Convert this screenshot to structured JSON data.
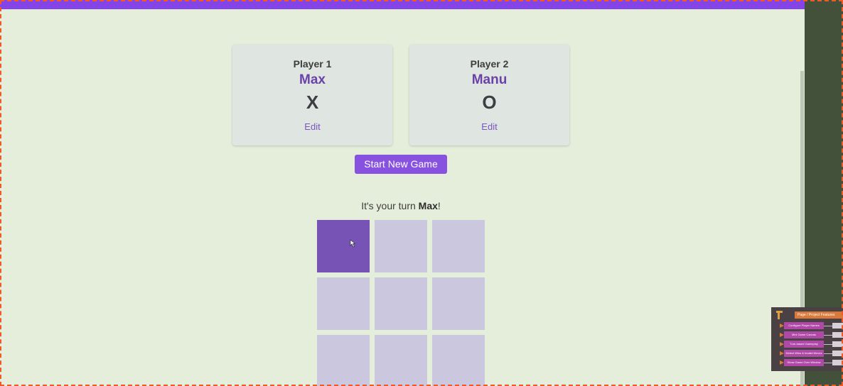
{
  "players": [
    {
      "label": "Player 1",
      "name": "Max",
      "symbol": "X",
      "edit_label": "Edit"
    },
    {
      "label": "Player 2",
      "name": "Manu",
      "symbol": "O",
      "edit_label": "Edit"
    }
  ],
  "start_button_label": "Start New Game",
  "turn": {
    "prefix": "It's your turn ",
    "player": "Max",
    "suffix": "!"
  },
  "board": {
    "cells": [
      "",
      "",
      "",
      "",
      "",
      "",
      "",
      "",
      ""
    ],
    "hovered_cell": 0
  },
  "colors": {
    "accent": "#8852e0",
    "player_name": "#6a42a8",
    "cell": "#cbc7de",
    "cell_hover": "#7653b5",
    "background": "#e5eedb"
  },
  "thumbnail": {
    "header": "Page / Project Features",
    "rows": [
      "Configure Player Names",
      "Mini Game Canvas",
      "Turn-based Gameplay",
      "Detect Wins & Invalid Moves",
      "Show Game Over Window"
    ]
  }
}
